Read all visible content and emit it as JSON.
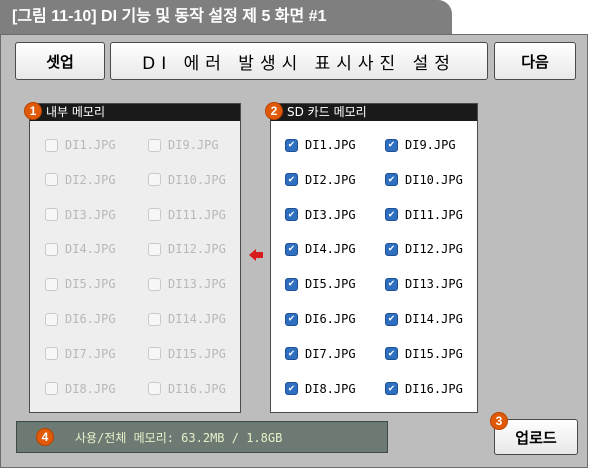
{
  "caption": "[그림 11-10] DI 기능 및 동작 설정 제 5 화면 #1",
  "toolbar": {
    "setup_label": "셋업",
    "title": "DI 에러 발생시 표시사진 설정",
    "next_label": "다음"
  },
  "internal_panel": {
    "header": "내부 메모리",
    "badge": "1",
    "files": [
      "DI1.JPG",
      "DI9.JPG",
      "DI2.JPG",
      "DI10.JPG",
      "DI3.JPG",
      "DI11.JPG",
      "DI4.JPG",
      "DI12.JPG",
      "DI5.JPG",
      "DI13.JPG",
      "DI6.JPG",
      "DI14.JPG",
      "DI7.JPG",
      "DI15.JPG",
      "DI8.JPG",
      "DI16.JPG"
    ]
  },
  "sd_panel": {
    "header": "SD 카드 메모리",
    "badge": "2",
    "files": [
      "DI1.JPG",
      "DI9.JPG",
      "DI2.JPG",
      "DI10.JPG",
      "DI3.JPG",
      "DI11.JPG",
      "DI4.JPG",
      "DI12.JPG",
      "DI5.JPG",
      "DI13.JPG",
      "DI6.JPG",
      "DI14.JPG",
      "DI7.JPG",
      "DI15.JPG",
      "DI8.JPG",
      "DI16.JPG"
    ]
  },
  "upload": {
    "label": "업로드",
    "badge": "3"
  },
  "status": {
    "badge": "4",
    "text": "사용/전체 메모리: 63.2MB  /  1.8GB"
  },
  "colors": {
    "accent": "#e05a0a",
    "checkbox": "#2f6fc0",
    "arrow": "#d81b1b",
    "status_bg": "#6d7a73"
  },
  "icons": {
    "transfer": "arrow-left-icon",
    "check": "checkmark-icon"
  }
}
